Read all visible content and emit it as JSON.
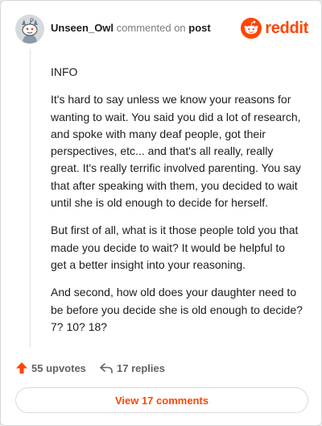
{
  "header": {
    "username": "Unseen_Owl",
    "action_text": "commented on",
    "post_link": "post",
    "brand": "reddit",
    "brand_color": "#ff4500"
  },
  "comment": {
    "paragraphs": [
      "INFO",
      "It's hard to say unless we know your reasons for wanting to wait. You said you did a lot of research, and spoke with many deaf people, got their perspectives, etc... and that's all really, really great. It's really terrific involved parenting. You say that after speaking with them, you decided to wait until she is old enough to decide for herself.",
      "But first of all, what is it those people told you that made you decide to wait? It would be helpful to get a better insight into your reasoning.",
      "And second, how old does your daughter need to be before you decide she is old enough to decide? 7? 10? 18?"
    ]
  },
  "footer": {
    "upvotes_label": "55 upvotes",
    "replies_label": "17 replies",
    "upvote_icon": "upvote-arrow-icon",
    "reply_icon": "reply-arrow-icon"
  },
  "view_comments_label": "View 17 comments"
}
